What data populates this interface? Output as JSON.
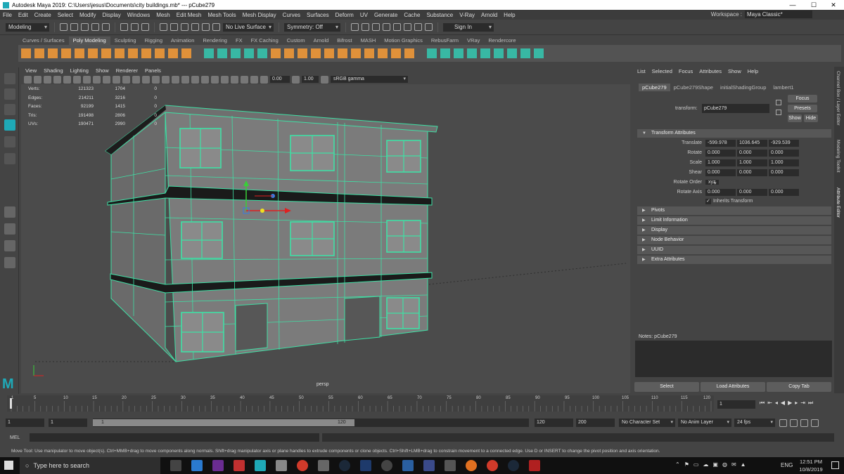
{
  "titlebar": {
    "title": "Autodesk Maya 2019: C:\\Users\\jesus\\Documents\\city buildings.mb*  ---  pCube279",
    "minimize": "—",
    "maximize": "☐",
    "close": "✕"
  },
  "menubar": {
    "items": [
      "File",
      "Edit",
      "Create",
      "Select",
      "Modify",
      "Display",
      "Windows",
      "Mesh",
      "Edit Mesh",
      "Mesh Tools",
      "Mesh Display",
      "Curves",
      "Surfaces",
      "Deform",
      "UV",
      "Generate",
      "Cache",
      "Substance",
      "V-Ray",
      "Arnold",
      "Help"
    ],
    "workspace_label": "Workspace :",
    "workspace_value": "Maya Classic*"
  },
  "statusline": {
    "mode": "Modeling",
    "live_surface": "No Live Surface",
    "symmetry": "Symmetry: Off",
    "sign_in": "Sign In"
  },
  "shelf": {
    "tabs": [
      "Curves / Surfaces",
      "Poly Modeling",
      "Sculpting",
      "Rigging",
      "Animation",
      "Rendering",
      "FX",
      "FX Caching",
      "Custom",
      "Arnold",
      "Bifrost",
      "MASH",
      "Motion Graphics",
      "RebusFarm",
      "VRay",
      "Rendercore"
    ],
    "active": "Poly Modeling"
  },
  "viewport": {
    "menu": [
      "View",
      "Shading",
      "Lighting",
      "Show",
      "Renderer",
      "Panels"
    ],
    "exposure": "0.00",
    "gamma": "1.00",
    "color_space": "sRGB gamma",
    "camera": "persp",
    "hud": [
      {
        "k": "Verts:",
        "a": "121323",
        "b": "1704",
        "c": "0"
      },
      {
        "k": "Edges:",
        "a": "214211",
        "b": "3216",
        "c": "0"
      },
      {
        "k": "Faces:",
        "a": "92199",
        "b": "1415",
        "c": "0"
      },
      {
        "k": "Tris:",
        "a": "191498",
        "b": "2806",
        "c": "0"
      },
      {
        "k": "UVs:",
        "a": "190471",
        "b": "2990",
        "c": "0"
      }
    ]
  },
  "attr": {
    "menu": [
      "List",
      "Selected",
      "Focus",
      "Attributes",
      "Show",
      "Help"
    ],
    "tabs": [
      "pCube279",
      "pCube279Shape",
      "initialShadingGroup",
      "lambert1"
    ],
    "active_tab": "pCube279",
    "transform_label": "transform:",
    "transform_value": "pCube279",
    "focus": "Focus",
    "presets": "Presets",
    "show": "Show",
    "hide": "Hide",
    "section": "Transform Attributes",
    "translate_label": "Translate",
    "translate": [
      "-599.978",
      "1036.645",
      "-929.539"
    ],
    "rotate_label": "Rotate",
    "rotate": [
      "0.000",
      "0.000",
      "0.000"
    ],
    "scale_label": "Scale",
    "scale": [
      "1.000",
      "1.000",
      "1.000"
    ],
    "shear_label": "Shear",
    "shear": [
      "0.000",
      "0.000",
      "0.000"
    ],
    "rotate_order_label": "Rotate Order",
    "rotate_order": "xyz",
    "rotate_axis_label": "Rotate Axis",
    "rotate_axis": [
      "0.000",
      "0.000",
      "0.000"
    ],
    "inherits": "Inherits Transform",
    "collapsed": [
      "Pivots",
      "Limit Information",
      "Display",
      "Node Behavior",
      "UUID",
      "Extra Attributes"
    ],
    "notes": "Notes:  pCube279",
    "select": "Select",
    "load": "Load Attributes",
    "copy": "Copy Tab"
  },
  "right_tabs": [
    "Channel Box / Layer Editor",
    "Modeling Toolkit",
    "Attribute Editor"
  ],
  "timeline": {
    "ticks": [
      "1",
      "5",
      "10",
      "15",
      "20",
      "25",
      "30",
      "35",
      "40",
      "45",
      "50",
      "55",
      "60",
      "65",
      "70",
      "75",
      "80",
      "85",
      "90",
      "95",
      "100",
      "105",
      "110",
      "115",
      "120"
    ],
    "current": "1"
  },
  "range": {
    "start": "1",
    "start2": "1",
    "slider_start": "1",
    "slider_end": "120",
    "end": "120",
    "end2": "200",
    "char_set": "No Character Set",
    "anim_layer": "No Anim Layer",
    "fps": "24 fps"
  },
  "mel": "MEL",
  "help": "Move Tool: Use manipulator to move object(s). Ctrl+MMB+drag to move components along normals. Shift+drag manipulator axis or plane handles to extrude components or clone objects. Ctrl+Shift+LMB+drag to constrain movement to a connected edge. Use D or INSERT to change the pivot position and axis orientation.",
  "taskbar": {
    "search": "Type here to search",
    "lang": "ENG",
    "time": "12:51 PM",
    "date": "10/8/2019"
  },
  "colors": {
    "wire": "#3fe0a5",
    "shelf_orange": "#e0913a",
    "shelf_teal": "#38b8a4",
    "accent": "#1fa9b7"
  }
}
